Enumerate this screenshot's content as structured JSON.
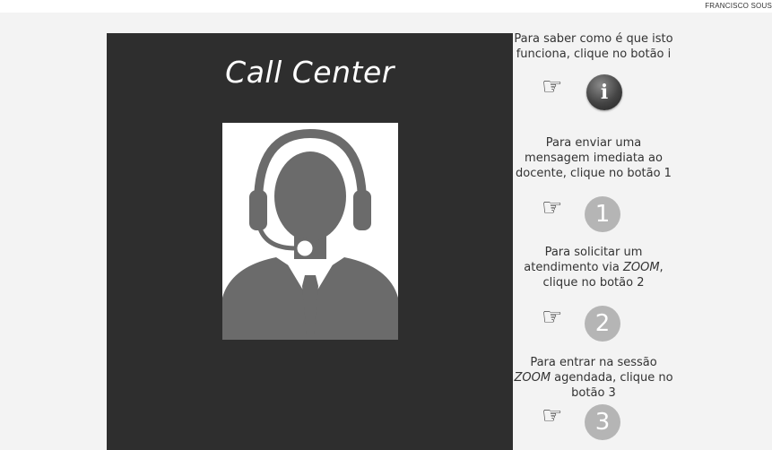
{
  "credit": "FRANCISCO SOUS",
  "panel": {
    "title": "Call Center"
  },
  "instructions": [
    {
      "pre": "Para saber como é que isto funciona, clique no botão i",
      "em": "",
      "post": ""
    },
    {
      "pre": "Para enviar uma mensagem imediata ao docente, clique no botão 1",
      "em": "",
      "post": ""
    },
    {
      "pre": "Para solicitar um atendimento via ",
      "em": "ZOOM",
      "post": ", clique no botão 2"
    },
    {
      "pre": "Para entrar na sessão ",
      "em": "ZOOM",
      "post": " agendada, clique no botão 3"
    }
  ],
  "buttons": [
    {
      "label": "i",
      "icon": "info-icon"
    },
    {
      "label": "1",
      "icon": "number-one-button"
    },
    {
      "label": "2",
      "icon": "number-two-button"
    },
    {
      "label": "3",
      "icon": "number-three-button"
    }
  ],
  "pointer_glyph": "☞",
  "colors": {
    "panel": "#2e2e2e",
    "background": "#f3f3f3",
    "button_gray": "#b5b5b5"
  }
}
